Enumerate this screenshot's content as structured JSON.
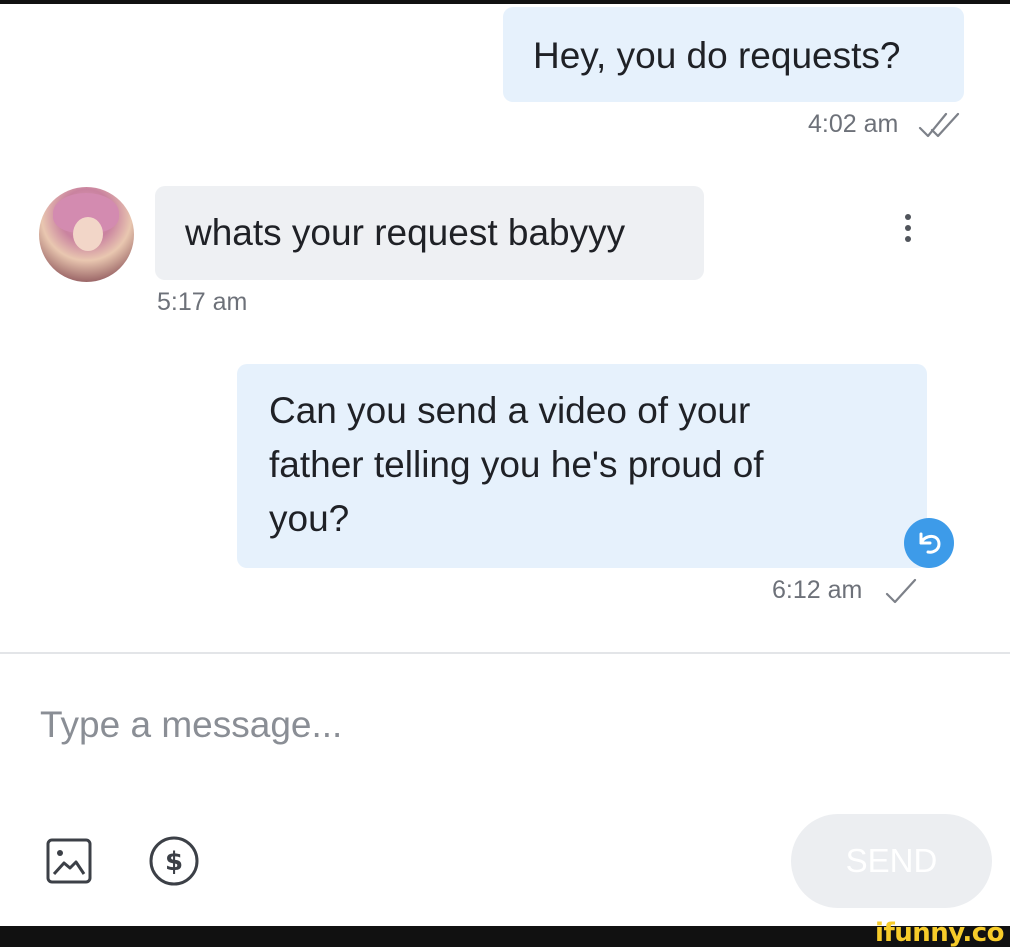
{
  "messages": [
    {
      "direction": "outgoing",
      "text": "Hey, you do requests?",
      "time": "4:02 am",
      "status": "read"
    },
    {
      "direction": "incoming",
      "text": "whats your request babyyy",
      "time": "5:17 am"
    },
    {
      "direction": "outgoing",
      "lines": [
        "Can you send a video of your",
        "father telling you he's proud of",
        "you?"
      ],
      "time": "6:12 am",
      "status": "sent"
    }
  ],
  "composer": {
    "placeholder": "Type a message...",
    "value": "",
    "send_label": "SEND"
  },
  "icons": {
    "more": "more-vertical-icon",
    "reply": "reply-icon",
    "read_status": "double-check-icon",
    "sent_status": "check-icon",
    "attach_image": "image-icon",
    "tip": "dollar-icon"
  },
  "colors": {
    "outgoing_bubble": "#e6f1fc",
    "incoming_bubble": "#eef0f3",
    "reply_accent": "#3d9be9",
    "send_disabled": "#eceef1"
  },
  "watermark": "ifunny.co"
}
